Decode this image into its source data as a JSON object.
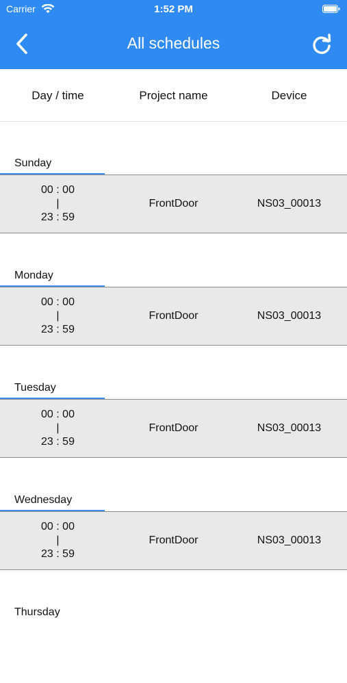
{
  "status_bar": {
    "carrier": "Carrier",
    "time": "1:52 PM",
    "wifi_icon": "wifi-icon",
    "battery_icon": "battery-icon"
  },
  "nav": {
    "title": "All schedules",
    "back_icon": "chevron-left-icon",
    "refresh_icon": "refresh-icon",
    "color": "#2f8bf2"
  },
  "columns": {
    "day_time": "Day / time",
    "project_name": "Project name",
    "device": "Device"
  },
  "days": [
    {
      "label": "Sunday",
      "start": "00 : 00",
      "sep": "|",
      "end": "23 : 59",
      "project": "FrontDoor",
      "device": "NS03_00013"
    },
    {
      "label": "Monday",
      "start": "00 : 00",
      "sep": "|",
      "end": "23 : 59",
      "project": "FrontDoor",
      "device": "NS03_00013"
    },
    {
      "label": "Tuesday",
      "start": "00 : 00",
      "sep": "|",
      "end": "23 : 59",
      "project": "FrontDoor",
      "device": "NS03_00013"
    },
    {
      "label": "Wednesday",
      "start": "00 : 00",
      "sep": "|",
      "end": "23 : 59",
      "project": "FrontDoor",
      "device": "NS03_00013"
    },
    {
      "label": "Thursday"
    }
  ]
}
